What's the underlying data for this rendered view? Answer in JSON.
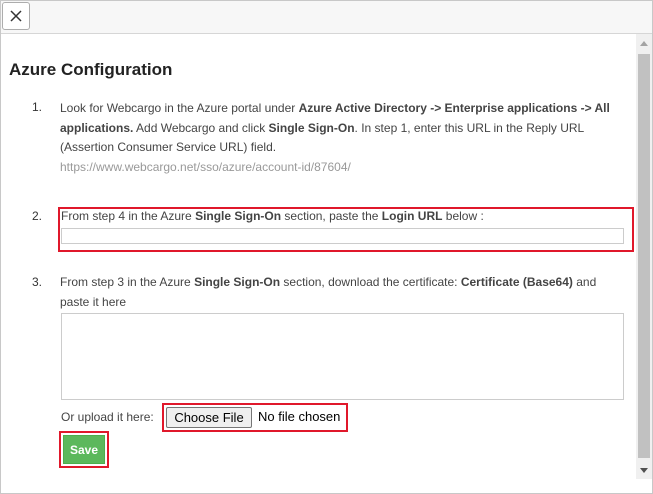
{
  "dialog": {
    "title": "Azure Configuration"
  },
  "colors": {
    "highlight": "#e0182b",
    "save_button": "#5cb85c",
    "url_text": "#999999"
  },
  "steps": [
    {
      "number": "1.",
      "text": {
        "t1": "Look for Webcargo in the Azure portal under ",
        "b1": "Azure Active Directory -> Enterprise applications -> All applications.",
        "t2": " Add Webcargo and click ",
        "b2": "Single Sign-On",
        "t3": ". In step 1, enter this URL in the Reply URL (Assertion Consumer Service URL) field."
      },
      "url": "https://www.webcargo.net/sso/azure/account-id/87604/"
    },
    {
      "number": "2.",
      "text": {
        "t1": "From step 4 in the Azure ",
        "b1": "Single Sign-On",
        "t2": " section, paste the ",
        "b2": "Login URL",
        "t3": " below :"
      },
      "input_value": ""
    },
    {
      "number": "3.",
      "text": {
        "t1": "From step 3 in the Azure ",
        "b1": "Single Sign-On",
        "t2": " section, download the certificate: ",
        "b2": "Certificate (Base64)",
        "t3": " and paste it here"
      },
      "textarea_value": "",
      "upload_label": "Or upload it here:",
      "file_button_label": "Choose File",
      "file_status": "No file chosen"
    }
  ],
  "save_label": "Save",
  "icons": {
    "close": "close-icon",
    "scroll_up": "scroll-up-arrow-icon",
    "scroll_down": "scroll-down-arrow-icon"
  }
}
